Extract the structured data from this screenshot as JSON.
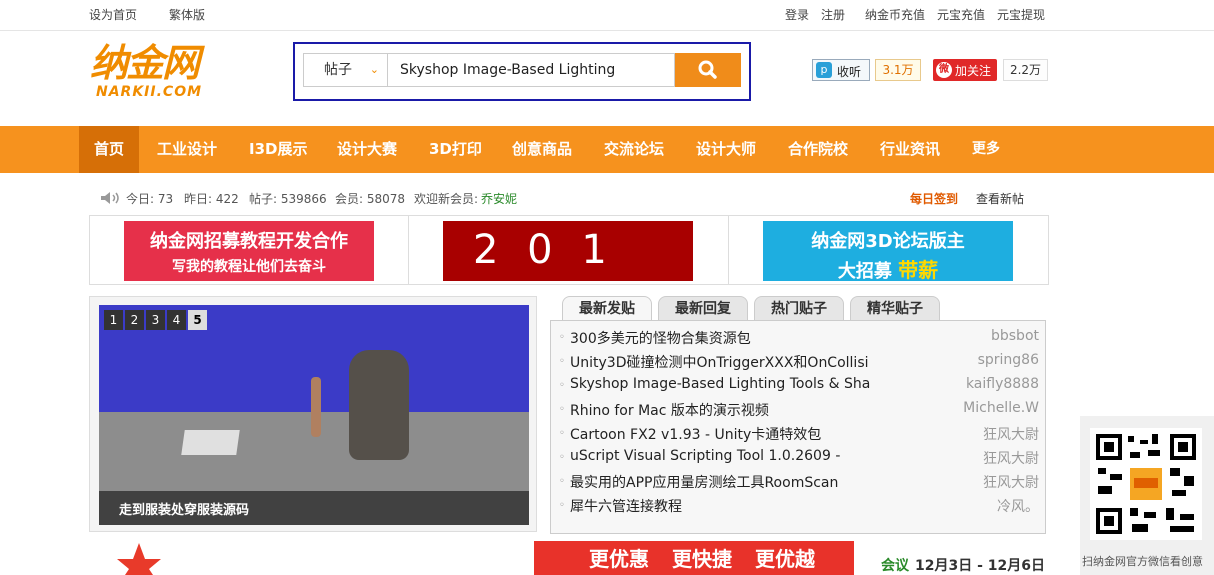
{
  "topbar": {
    "left": [
      "设为首页",
      "繁体版"
    ],
    "right": [
      "登录",
      "注册",
      "纳金币充值",
      "元宝充值",
      "元宝提现"
    ]
  },
  "logo": {
    "cn": "纳金网",
    "en": "NARKII.COM"
  },
  "search": {
    "type": "帖子",
    "value": "Skyshop Image-Based Lighting"
  },
  "social": {
    "listen_label": "收听",
    "listen_count": "3.1万",
    "follow_label": "加关注",
    "follow_count": "2.2万"
  },
  "nav": [
    "首页",
    "工业设计",
    "I3D展示",
    "设计大赛",
    "3D打印",
    "创意商品",
    "交流论坛",
    "设计大师",
    "合作院校",
    "行业资讯",
    "更多"
  ],
  "stats": {
    "today": "今日: 73",
    "yesterday": "昨日: 422",
    "posts": "帖子: 539866",
    "members": "会员: 58078",
    "welcome": "欢迎新会员:",
    "new_member": "乔安妮",
    "signin": "每日签到",
    "new_posts": "查看新帖"
  },
  "banners": {
    "b1_line1": "纳金网招募教程开发合作",
    "b1_line2": "写我的教程让他们去奋斗",
    "b2": "2 0 1",
    "b3_line1": "纳金网3D论坛版主",
    "b3_line2": "大招募",
    "b3_highlight": "带薪"
  },
  "slider": {
    "pages": [
      "1",
      "2",
      "3",
      "4",
      "5"
    ],
    "active_page": "5",
    "caption": "走到服装处穿服装源码"
  },
  "tabs": [
    "最新发贴",
    "最新回复",
    "热门贴子",
    "精华贴子"
  ],
  "posts": [
    {
      "title": "300多美元的怪物合集资源包",
      "author": "bbsbot"
    },
    {
      "title": "Unity3D碰撞检测中OnTriggerXXX和OnCollisi",
      "author": "spring86"
    },
    {
      "title": "Skyshop Image-Based Lighting Tools & Sha",
      "author": "kaifly8888"
    },
    {
      "title": "Rhino for Mac 版本的演示视频",
      "author": "Michelle.W"
    },
    {
      "title": "Cartoon FX2 v1.93 - Unity卡通特效包",
      "author": "狂风大尉"
    },
    {
      "title": "uScript Visual Scripting Tool 1.0.2609 -",
      "author": "狂风大尉"
    },
    {
      "title": "最实用的APP应用量房测绘工具RoomScan",
      "author": "狂风大尉"
    },
    {
      "title": "犀牛六管连接教程",
      "author": "冷风。"
    }
  ],
  "qr_caption": "扫纳金网官方微信看创意",
  "bottom_banner": {
    "p1": "更优惠",
    "p2": "更快捷",
    "p3": "更优越",
    "meeting": "会议",
    "dates": "12月3日 - 12月6日"
  },
  "colors": {
    "brand_orange": "#f6921e",
    "nav_active": "#d66f07",
    "search_border": "#1a1aa8"
  }
}
